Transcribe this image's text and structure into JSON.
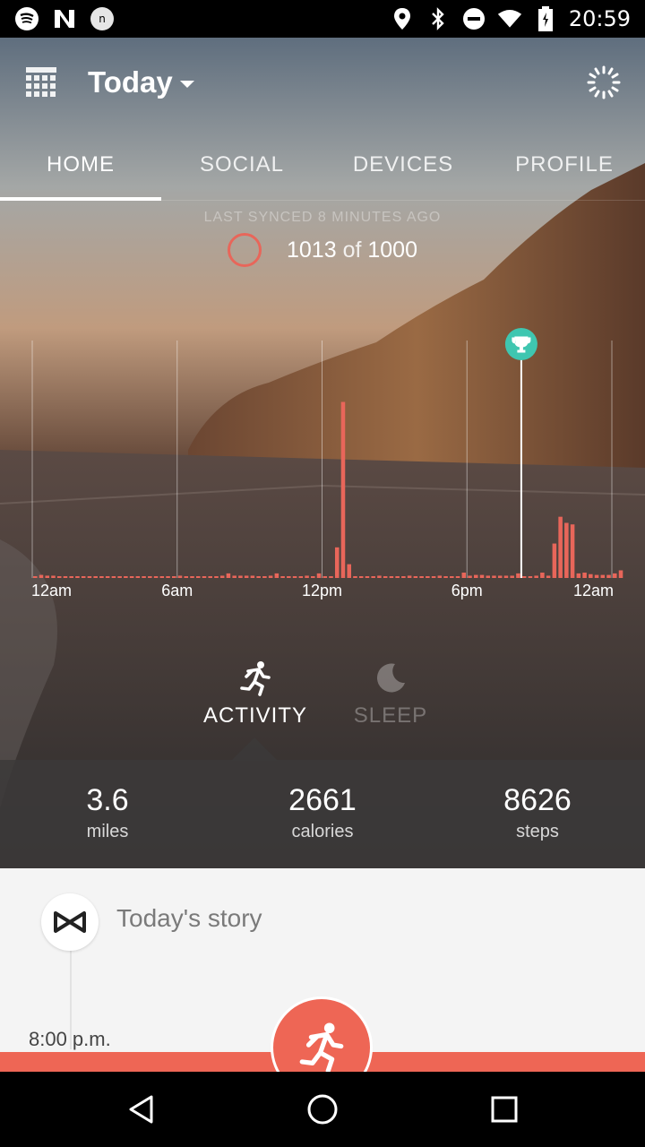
{
  "status_bar": {
    "time": "20:59",
    "left_icons": [
      "spotify-icon",
      "n-app-icon",
      "notification-icon"
    ],
    "right_icons": [
      "location-icon",
      "bluetooth-icon",
      "do-not-disturb-icon",
      "wifi-icon",
      "battery-icon"
    ]
  },
  "header": {
    "date_label": "Today",
    "calendar_icon": "calendar-icon",
    "sync_icon": "sync-spinner-icon"
  },
  "tabs": [
    {
      "label": "HOME",
      "active": true
    },
    {
      "label": "SOCIAL",
      "active": false
    },
    {
      "label": "DEVICES",
      "active": false
    },
    {
      "label": "PROFILE",
      "active": false
    }
  ],
  "sync": {
    "last_synced": "LAST SYNCED 8 MINUTES AGO"
  },
  "goal": {
    "value": "1013",
    "of": "of",
    "target": "1000"
  },
  "chart_data": {
    "type": "bar",
    "x_tick_labels": [
      "12am",
      "6am",
      "12pm",
      "6pm",
      "12am"
    ],
    "goal_marker_icon": "trophy-icon",
    "goal_reached_hour": 20.25,
    "bar_color": "#e8665a",
    "values": [
      2,
      4,
      3,
      3,
      2,
      2,
      2,
      2,
      2,
      2,
      2,
      2,
      2,
      2,
      2,
      2,
      2,
      2,
      2,
      2,
      2,
      2,
      2,
      2,
      3,
      2,
      2,
      2,
      2,
      2,
      2,
      3,
      6,
      3,
      3,
      3,
      3,
      2,
      2,
      3,
      6,
      2,
      2,
      2,
      2,
      3,
      2,
      6,
      2,
      2,
      40,
      230,
      18,
      2,
      2,
      2,
      2,
      3,
      2,
      2,
      2,
      2,
      3,
      2,
      2,
      2,
      2,
      3,
      2,
      2,
      2,
      7,
      2,
      6,
      3,
      3,
      3,
      3,
      3,
      3,
      2,
      2,
      3,
      3,
      3,
      3,
      4,
      2,
      2,
      3,
      3,
      4,
      2,
      2,
      3,
      2,
      2,
      3,
      2,
      3,
      3,
      3,
      3,
      3,
      3,
      3,
      3,
      3,
      3,
      3,
      3,
      3,
      3,
      3,
      3,
      3,
      3,
      3,
      3,
      3,
      3,
      3,
      3,
      3,
      3,
      3,
      3,
      3,
      3,
      3,
      3,
      3,
      3,
      3,
      3,
      3,
      3,
      3,
      3,
      3,
      3,
      3,
      3,
      3,
      3,
      3,
      3,
      3
    ],
    "evening_values": [
      3,
      4,
      4,
      3,
      3,
      3,
      3,
      3,
      6,
      2,
      2,
      3,
      7,
      3,
      45,
      80,
      72,
      70,
      6,
      7,
      5,
      4,
      4,
      4,
      6,
      10
    ]
  },
  "modes": {
    "activity": {
      "label": "ACTIVITY",
      "icon": "running-icon",
      "selected": true
    },
    "sleep": {
      "label": "SLEEP",
      "icon": "moon-icon",
      "selected": false
    }
  },
  "stats": [
    {
      "value": "3.6",
      "unit": "miles"
    },
    {
      "value": "2661",
      "unit": "calories"
    },
    {
      "value": "8626",
      "unit": "steps"
    }
  ],
  "story": {
    "title": "Today's story",
    "time": "8:00 p.m.",
    "logo_icon": "misfit-logo-icon",
    "fab_icon": "running-icon",
    "accent": "#ee6655"
  },
  "nav": {
    "back_icon": "back-triangle-icon",
    "home_icon": "home-circle-icon",
    "recents_icon": "recents-square-icon"
  }
}
